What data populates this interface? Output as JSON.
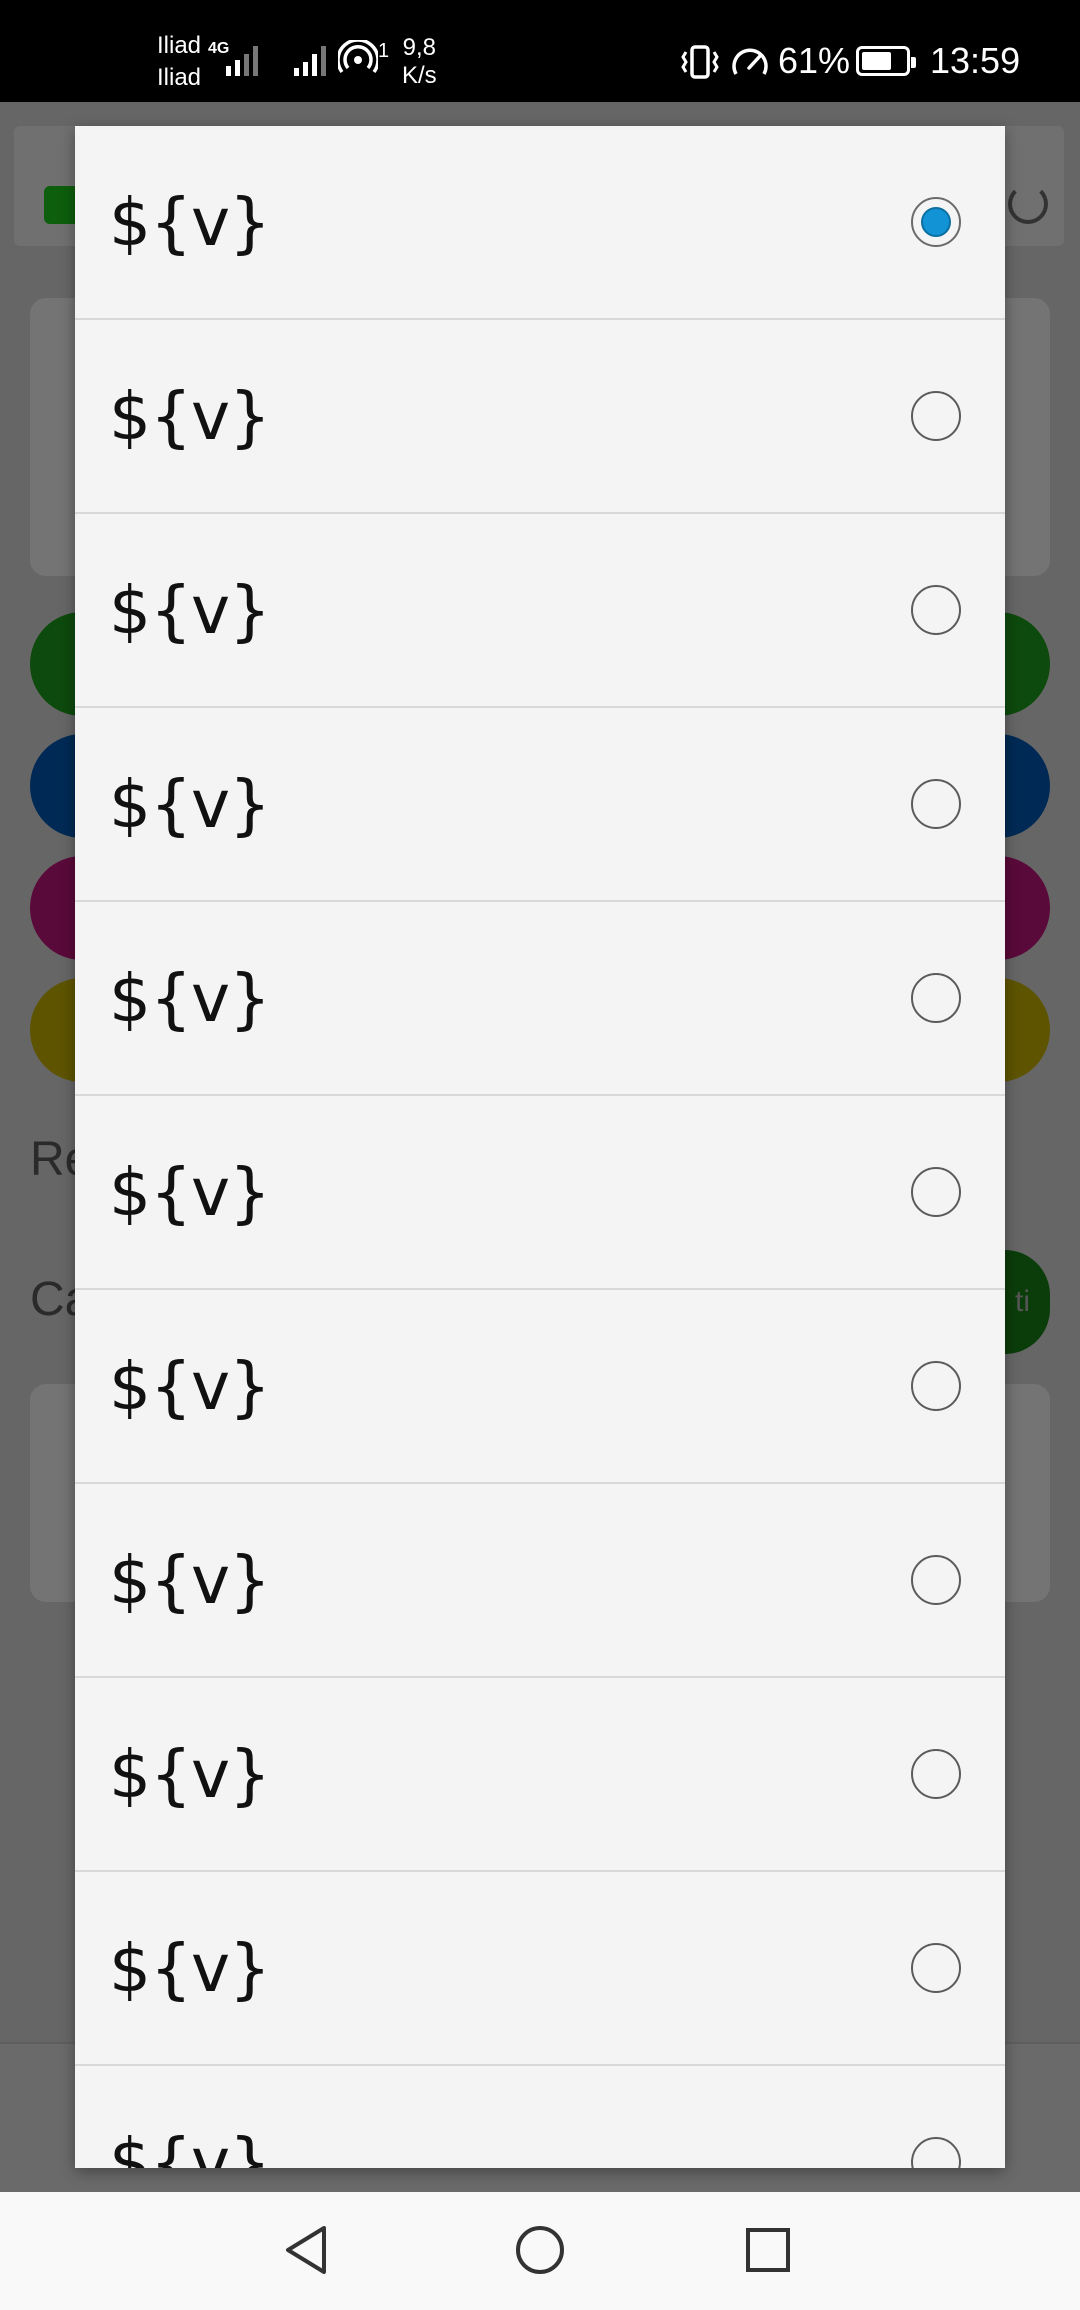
{
  "status_bar": {
    "carrier_1": "Iliad",
    "carrier_2": "Iliad",
    "network_type": "4G",
    "hotspot_count": "1",
    "speed_value": "9,8",
    "speed_unit": "K/s",
    "battery_percent": "61%",
    "time": "13:59"
  },
  "background": {
    "text_1": "Re",
    "text_2": "Ca",
    "green_button_fragment": "ti",
    "pill_colors": [
      "#0d4a0d",
      "#002a55",
      "#5a0a3a",
      "#5e5400"
    ]
  },
  "dialog": {
    "options": [
      {
        "label": "${v}",
        "selected": true
      },
      {
        "label": "${v}",
        "selected": false
      },
      {
        "label": "${v}",
        "selected": false
      },
      {
        "label": "${v}",
        "selected": false
      },
      {
        "label": "${v}",
        "selected": false
      },
      {
        "label": "${v}",
        "selected": false
      },
      {
        "label": "${v}",
        "selected": false
      },
      {
        "label": "${v}",
        "selected": false
      },
      {
        "label": "${v}",
        "selected": false
      },
      {
        "label": "${v}",
        "selected": false
      },
      {
        "label": "${v}",
        "selected": false
      }
    ],
    "accent_color": "#1293d6"
  },
  "nav_bar": {
    "back_icon": "triangle-back-icon",
    "home_icon": "circle-home-icon",
    "recent_icon": "square-recents-icon"
  }
}
